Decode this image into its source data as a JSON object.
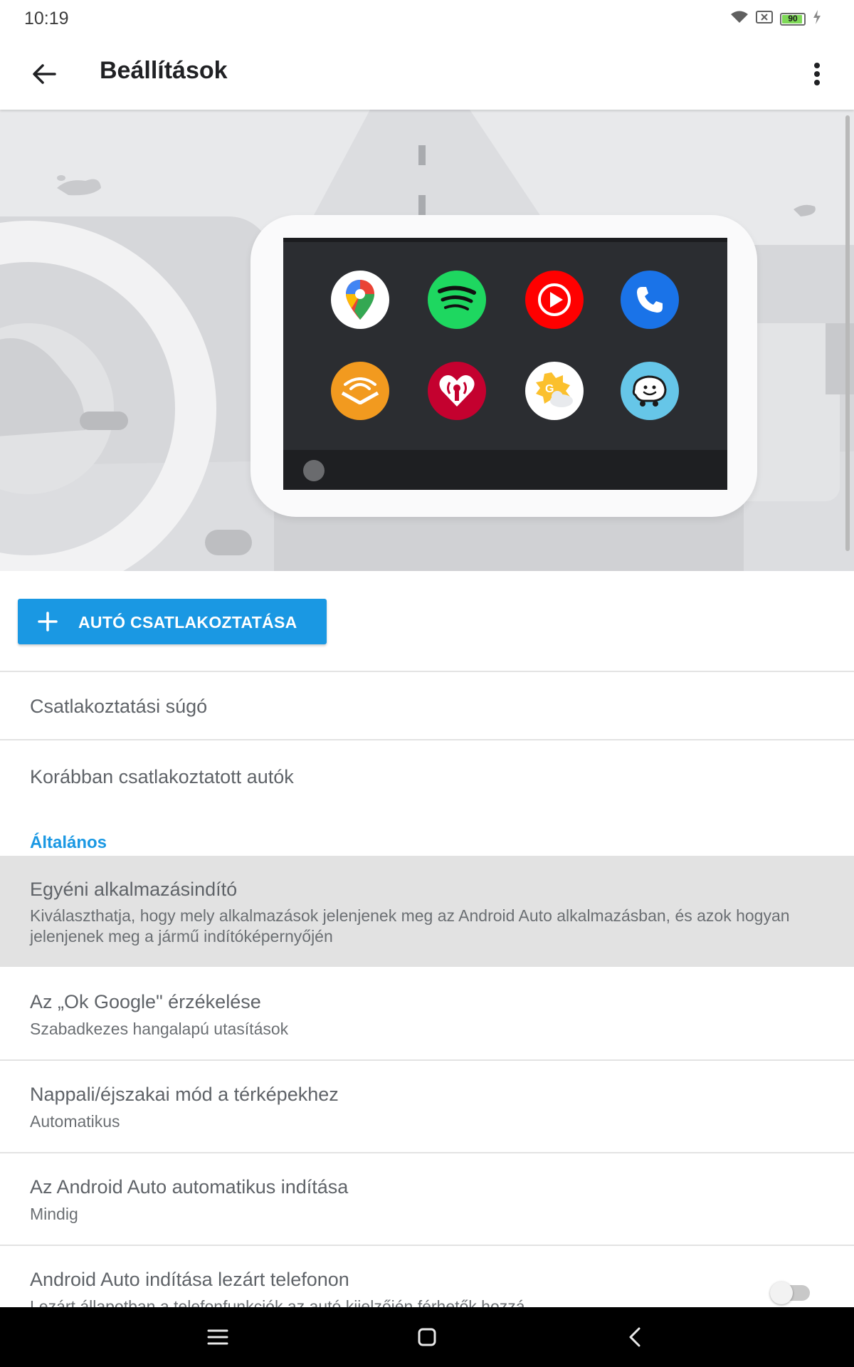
{
  "status_bar": {
    "time": "10:19",
    "battery_level": "90",
    "icons": [
      "wifi-icon",
      "no-sim-icon",
      "battery-icon",
      "charging-icon"
    ]
  },
  "app_bar": {
    "title": "Beállítások",
    "icons": [
      "back-arrow-icon",
      "more-vert-icon"
    ]
  },
  "hero": {
    "apps": [
      {
        "name": "Google Maps",
        "icon": "maps-icon",
        "color": "#ffffff"
      },
      {
        "name": "Spotify",
        "icon": "spotify-icon",
        "color": "#1ed760"
      },
      {
        "name": "YouTube Music",
        "icon": "youtube-music-icon",
        "color": "#ff0000"
      },
      {
        "name": "Phone",
        "icon": "phone-icon",
        "color": "#1a73e8"
      },
      {
        "name": "Audible",
        "icon": "audible-icon",
        "color": "#f29a1f"
      },
      {
        "name": "iHeartRadio",
        "icon": "iheartradio-icon",
        "color": "#c4012f"
      },
      {
        "name": "Google Weather",
        "icon": "weather-icon",
        "color": "#ffffff"
      },
      {
        "name": "Waze",
        "icon": "waze-icon",
        "color": "#66c6e8"
      }
    ]
  },
  "connect_button": {
    "label": "AUTÓ CSATLAKOZTATÁSA"
  },
  "list": {
    "connection_help": "Csatlakoztatási súgó",
    "previous_cars": "Korábban csatlakoztatott autók",
    "section_general": "Általános",
    "custom_launcher": {
      "title": "Egyéni alkalmazásindító",
      "subtitle": "Kiválaszthatja, hogy mely alkalmazások jelenjenek meg az Android Auto alkalmazásban, és azok hogyan jelenjenek meg a jármű indítóképernyőjén"
    },
    "ok_google": {
      "title": "Az „Ok Google\" érzékelése",
      "subtitle": "Szabadkezes hangalapú utasítások"
    },
    "day_night": {
      "title": "Nappali/éjszakai mód a térképekhez",
      "subtitle": "Automatikus"
    },
    "auto_start": {
      "title": "Az Android Auto automatikus indítása",
      "subtitle": "Mindig"
    },
    "locked_start": {
      "title": "Android Auto indítása lezárt telefonon",
      "subtitle": "Lezárt állapotban a telefonfunkciók az autó kijelzőjén férhetők hozzá",
      "toggle_on": false
    }
  },
  "nav_bar": {
    "icons": [
      "menu-icon",
      "home-icon",
      "back-icon"
    ]
  },
  "colors": {
    "accent": "#1a98e3",
    "highlight_row": "#e2e2e2"
  }
}
